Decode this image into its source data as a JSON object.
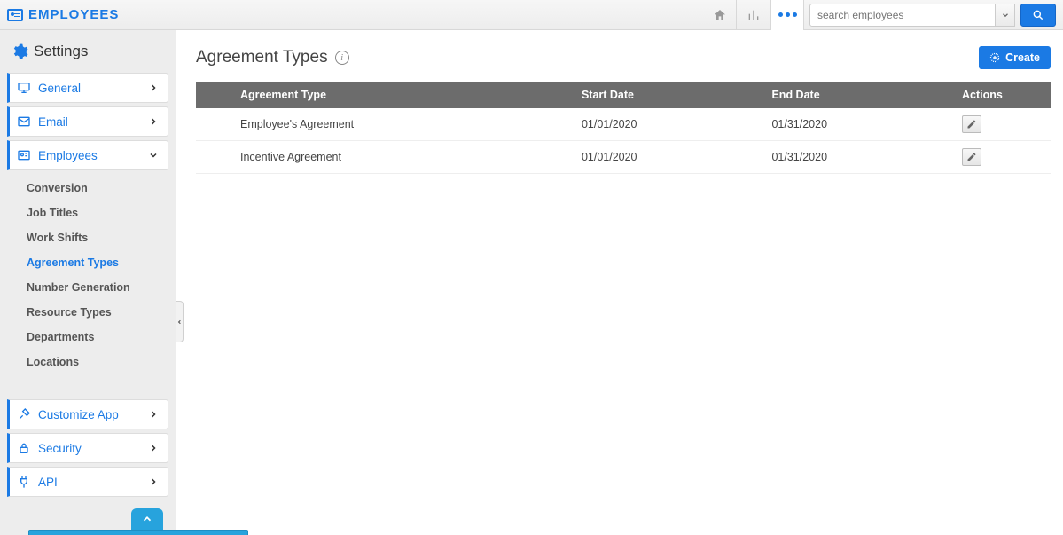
{
  "app": {
    "title": "EMPLOYEES"
  },
  "topbar": {
    "search_placeholder": "search employees"
  },
  "sidebar": {
    "title": "Settings",
    "items": [
      {
        "label": "General",
        "expanded": false
      },
      {
        "label": "Email",
        "expanded": false
      },
      {
        "label": "Employees",
        "expanded": true
      },
      {
        "label": "Customize App",
        "expanded": false
      },
      {
        "label": "Security",
        "expanded": false
      },
      {
        "label": "API",
        "expanded": false
      }
    ],
    "sub_employees": [
      {
        "label": "Conversion",
        "active": false
      },
      {
        "label": "Job Titles",
        "active": false
      },
      {
        "label": "Work Shifts",
        "active": false
      },
      {
        "label": "Agreement Types",
        "active": true
      },
      {
        "label": "Number Generation",
        "active": false
      },
      {
        "label": "Resource Types",
        "active": false
      },
      {
        "label": "Departments",
        "active": false
      },
      {
        "label": "Locations",
        "active": false
      }
    ]
  },
  "page": {
    "title": "Agreement Types",
    "create_label": "Create"
  },
  "table": {
    "columns": {
      "c0": "",
      "c1": "Agreement Type",
      "c2": "Start Date",
      "c3": "End Date",
      "c4": "Actions"
    },
    "rows": [
      {
        "type": "Employee's Agreement",
        "start": "01/01/2020",
        "end": "01/31/2020"
      },
      {
        "type": "Incentive Agreement",
        "start": "01/01/2020",
        "end": "01/31/2020"
      }
    ]
  }
}
